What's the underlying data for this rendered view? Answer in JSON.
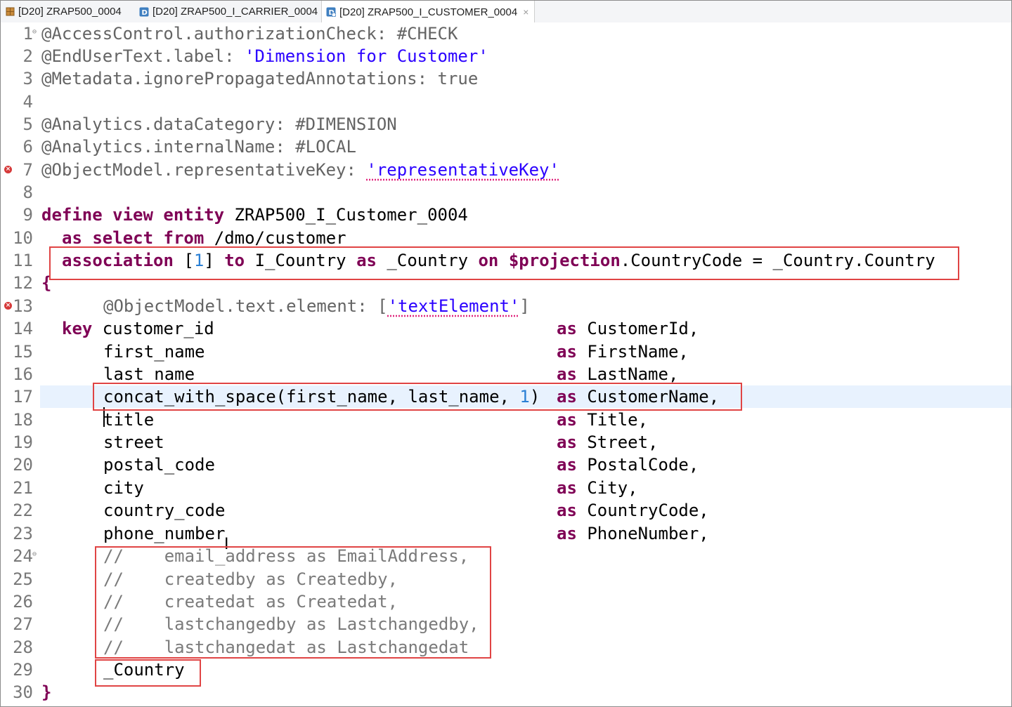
{
  "tabs": [
    {
      "label": "[D20] ZRAP500_0004",
      "icon": "package-icon",
      "active": false
    },
    {
      "label": "[D20] ZRAP500_I_CARRIER_0004",
      "icon": "data-definition-icon",
      "active": false
    },
    {
      "label": "[D20] ZRAP500_I_CUSTOMER_0004",
      "icon": "data-definition-edit-icon",
      "active": true
    }
  ],
  "close_glyph": "×",
  "editor": {
    "current_line": 17,
    "lines": [
      {
        "n": "1"
      },
      {
        "n": "2"
      },
      {
        "n": "3"
      },
      {
        "n": "4"
      },
      {
        "n": "5"
      },
      {
        "n": "6"
      },
      {
        "n": "7"
      },
      {
        "n": "8"
      },
      {
        "n": "9"
      },
      {
        "n": "10"
      },
      {
        "n": "11"
      },
      {
        "n": "12"
      },
      {
        "n": "13"
      },
      {
        "n": "14"
      },
      {
        "n": "15"
      },
      {
        "n": "16"
      },
      {
        "n": "17"
      },
      {
        "n": "18"
      },
      {
        "n": "19"
      },
      {
        "n": "20"
      },
      {
        "n": "21"
      },
      {
        "n": "22"
      },
      {
        "n": "23"
      },
      {
        "n": "24"
      },
      {
        "n": "25"
      },
      {
        "n": "26"
      },
      {
        "n": "27"
      },
      {
        "n": "28"
      },
      {
        "n": "29"
      },
      {
        "n": "30"
      }
    ],
    "t": {
      "l1a": "@AccessControl.authorizationCheck: #CHECK",
      "l2a": "@EndUserText.label: ",
      "l2b": "'Dimension for Customer'",
      "l3a": "@Metadata.ignorePropagatedAnnotations: true",
      "l5a": "@Analytics.dataCategory: #DIMENSION",
      "l6a": "@Analytics.internalName: #LOCAL",
      "l7a": "@ObjectModel.representativeKey: ",
      "l7b": "'representativeKey'",
      "l9a": "define view entity",
      "l9b": " ZRAP500_I_Customer_0004",
      "l10a": "as select from",
      "l10b": " /dmo/customer",
      "l11a": "association",
      "l11b": " [",
      "l11c": "1",
      "l11d": "] ",
      "l11e": "to",
      "l11f": " I_Country ",
      "l11g": "as",
      "l11h": " _Country ",
      "l11i": "on",
      "l11j": " $projection",
      "l11k": ".CountryCode = _Country",
      "l11l": ".Country",
      "l12a": "{",
      "l13a": "@ObjectModel.text.element: [",
      "l13b": "'textElement'",
      "l13c": "]",
      "l14a": "key",
      "l14b": " customer_id",
      "l14c": "as",
      "l14d": " CustomerId,",
      "l15a": "first_name",
      "l15c": "as",
      "l15d": " FirstName,",
      "l16a": "last_name",
      "l16c": "as",
      "l16d": " LastName,",
      "l17a": "concat_with_space(first_name, last_name, ",
      "l17b": "1",
      "l17c": ")",
      "l17d": "as",
      "l17e": " CustomerName,",
      "l18a": "title",
      "l18c": "as",
      "l18d": " Title,",
      "l19a": "street",
      "l19c": "as",
      "l19d": " Street,",
      "l20a": "postal_code",
      "l20c": "as",
      "l20d": " PostalCode,",
      "l21a": "city",
      "l21c": "as",
      "l21d": " City,",
      "l22a": "country_code",
      "l22c": "as",
      "l22d": " CountryCode,",
      "l23a": "phone_number",
      "l23c": "as",
      "l23d": " PhoneNumber,",
      "l24a": "//    email_address as EmailAddress,",
      "l25a": "//    createdby as Createdby,",
      "l26a": "//    createdat as Createdat,",
      "l27a": "//    lastchangedby as Lastchangedby,",
      "l28a": "//    lastchangedat as Lastchangedat",
      "l29a": "_Country",
      "l30a": "}"
    }
  },
  "colors": {
    "keyword": "#7f0055",
    "string": "#2a00ff",
    "annotation": "#646464",
    "number": "#2a7fd4",
    "comment": "#7a7a7a",
    "highlight_box": "#e04444",
    "current_line": "#e8f2fe",
    "error_marker": "#d63a3a"
  }
}
